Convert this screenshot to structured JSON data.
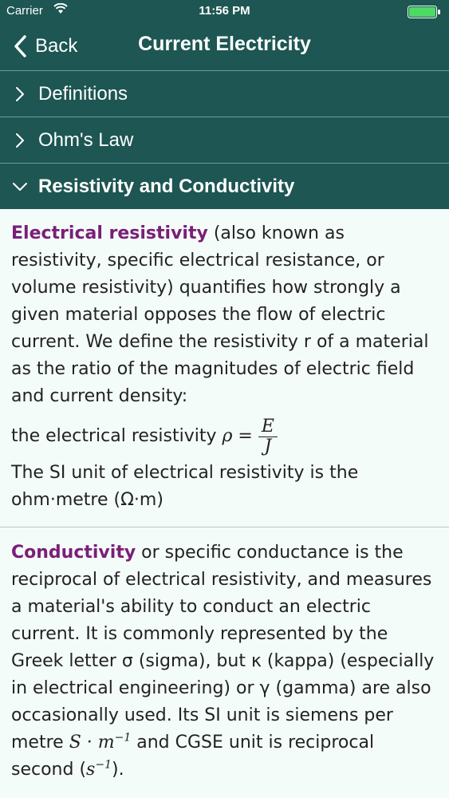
{
  "status": {
    "carrier": "Carrier",
    "time": "11:56 PM"
  },
  "nav": {
    "back_label": "Back",
    "title": "Current Electricity"
  },
  "sections": [
    {
      "label": "Definitions",
      "expanded": false
    },
    {
      "label": "Ohm's Law",
      "expanded": false
    },
    {
      "label": "Resistivity and Conductivity",
      "expanded": true
    }
  ],
  "resistivity": {
    "term": "Electrical resistivity",
    "text": " (also known as resistivity, specific electrical resistance, or volume resistivity) quantifies how strongly a given material opposes the flow of electric current. We define the resistivity r of a material as the ratio of the magnitudes of electric field and current density:",
    "formula_prefix": "the electrical resistivity ",
    "formula_lhs": "ρ =",
    "formula_num": "E",
    "formula_den": "J",
    "unit_text": "The SI unit of electrical resistivity is the ohm·metre (Ω·m)"
  },
  "conductivity": {
    "term": "Conductivity",
    "text": " or specific conductance is the reciprocal of electrical resistivity, and measures a material's ability to conduct an electric current. It is commonly represented by the Greek letter σ (sigma), but κ (kappa) (especially in electrical engineering) or γ (gamma) are also occasionally used. Its SI unit is siemens per metre ",
    "unit_si": "S · m",
    "unit_si_exp": "−1",
    "text2": " and CGSE unit is reciprocal second (",
    "unit_cgse": "s",
    "unit_cgse_exp": "−1",
    "text3": ")."
  },
  "colors": {
    "header": "#1d5653",
    "term": "#7a1f78",
    "battery": "#4cd964"
  }
}
